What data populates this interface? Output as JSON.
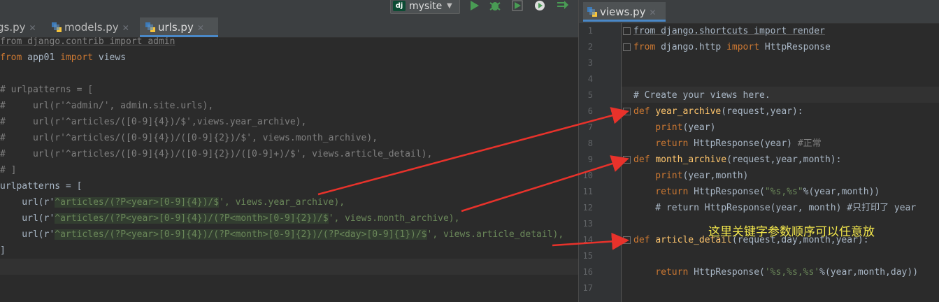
{
  "toolbar": {
    "run_config": "mysite",
    "dj_badge": "dj"
  },
  "left_tabs": [
    {
      "label": "gs.py"
    },
    {
      "label": "models.py"
    },
    {
      "label": "urls.py"
    }
  ],
  "right_tabs": [
    {
      "label": "views.py"
    }
  ],
  "left_code": {
    "l1": "from django.contrib import admin",
    "l2_kw": "from",
    "l2_mid": " app01 ",
    "l2_kw2": "import",
    "l2_end": " views",
    "l4": "# urlpatterns = [",
    "l5": "#     url(r'^admin/', admin.site.urls),",
    "l6": "#     url(r'^articles/([0-9]{4})/$',views.year_archive),",
    "l7": "#     url(r'^articles/([0-9]{4})/([0-9]{2})/$', views.month_archive),",
    "l8": "#     url(r'^articles/([0-9]{4})/([0-9]{2})/([0-9]+)/$', views.article_detail),",
    "l9": "# ]",
    "l10": "urlpatterns = [",
    "l11_a": "    url(r'",
    "l11_rx": "^articles/(?P<year>[0-9]{4})/$",
    "l11_b": "', views.year_archive),",
    "l12_a": "    url(r'",
    "l12_rx": "^articles/(?P<year>[0-9]{4})/(?P<month>[0-9]{2})/$",
    "l12_b": "', views.month_archive),",
    "l13_a": "    url(r'",
    "l13_rx": "^articles/(?P<year>[0-9]{4})/(?P<month>[0-9]{2})/(?P<day>[0-9]{1})/$",
    "l13_b": "', views.article_detail),",
    "l14": "]"
  },
  "right_code": {
    "line_numbers": [
      "1",
      "2",
      "3",
      "4",
      "5",
      "6",
      "7",
      "8",
      "9",
      "10",
      "11",
      "12",
      "13",
      "14",
      "15",
      "16",
      "17"
    ],
    "r1": "from django.shortcuts import render",
    "r2_kw": "from",
    "r2_mid": " django.http ",
    "r2_kw2": "import",
    "r2_end": " HttpResponse",
    "r5": "# Create your views here.",
    "r6_kw": "def ",
    "r6_fn": "year_archive",
    "r6_args": "(request,year):",
    "r7_fn": "    print",
    "r7_args": "(year)",
    "r8_kw": "    return",
    "r8_mid": " HttpResponse(year) ",
    "r8_cm": "#正常",
    "r9_kw": "def ",
    "r9_fn": "month_archive",
    "r9_args": "(request,year,month):",
    "r10_fn": "    print",
    "r10_args": "(year,month)",
    "r11_kw": "    return",
    "r11_mid": " HttpResponse(",
    "r11_str": "\"%s,%s\"",
    "r11_end": "%(year,month))",
    "r12": "    # return HttpResponse(year, month) #只打印了 year",
    "r14_kw": "def ",
    "r14_fn": "article_detail",
    "r14_args": "(request,day,month,year):",
    "r16_kw": "    return",
    "r16_mid": " HttpResponse(",
    "r16_str": "'%s,%s,%s'",
    "r16_end": "%(year,month,day))"
  },
  "annotation": "这里关键字参数顺序可以任意放",
  "colors": {
    "arrow": "#e8322b",
    "annotation": "#f5e94c",
    "keyword": "#cc7832",
    "string": "#6a8759"
  }
}
